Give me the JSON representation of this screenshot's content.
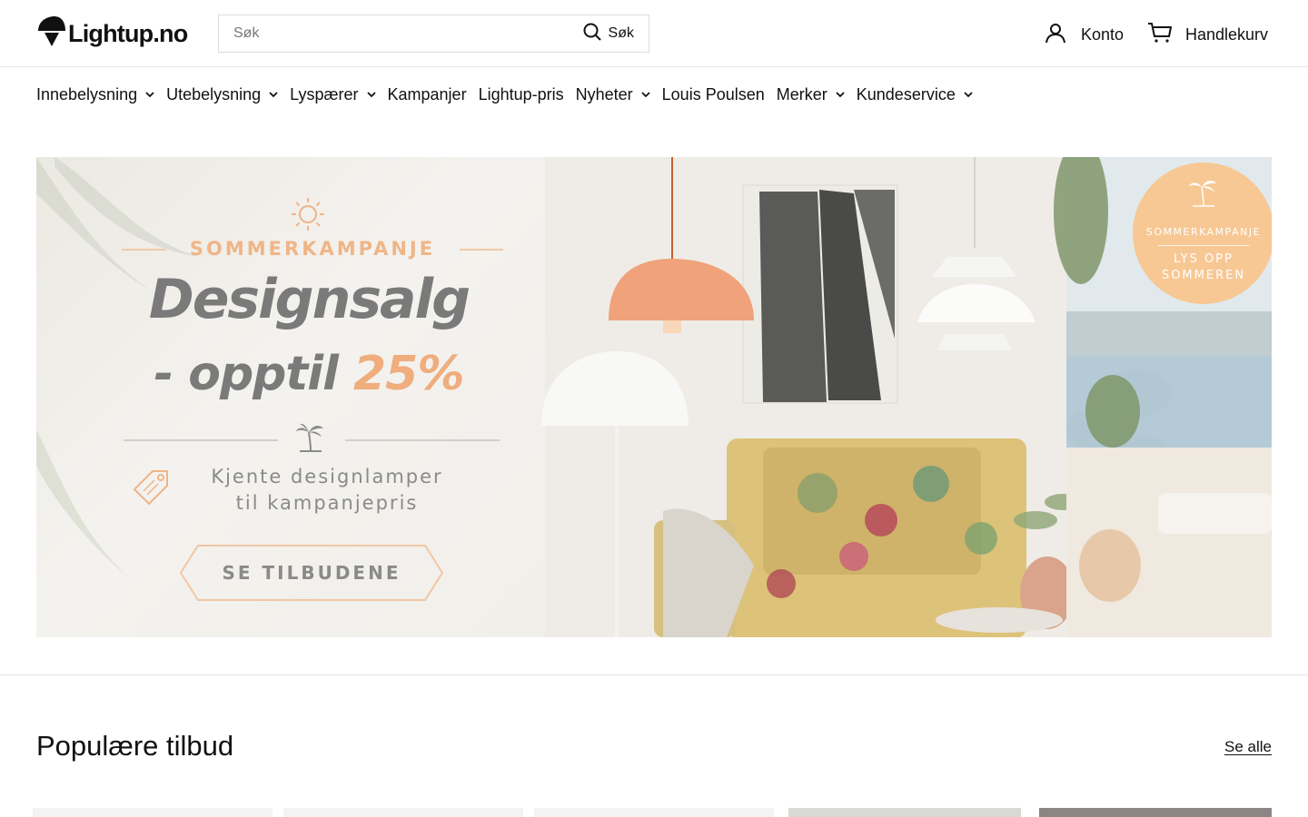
{
  "header": {
    "logo_text": "Lightup.no",
    "search": {
      "placeholder": "Søk",
      "button_label": "Søk"
    },
    "account_label": "Konto",
    "cart_label": "Handlekurv"
  },
  "nav": {
    "items": [
      {
        "label": "Innebelysning",
        "dropdown": true
      },
      {
        "label": "Utebelysning",
        "dropdown": true
      },
      {
        "label": "Lyspærer",
        "dropdown": true
      },
      {
        "label": "Kampanjer",
        "dropdown": false
      },
      {
        "label": "Lightup-pris",
        "dropdown": false
      },
      {
        "label": "Nyheter",
        "dropdown": true
      },
      {
        "label": "Louis Poulsen",
        "dropdown": false
      },
      {
        "label": "Merker",
        "dropdown": true
      },
      {
        "label": "Kundeservice",
        "dropdown": true
      }
    ]
  },
  "banner": {
    "season": "SOMMERKAMPANJE",
    "headline": "Designsalg",
    "subline_prefix": "- opptil ",
    "subline_percent": "25%",
    "tagline_1": "Kjente designlamper",
    "tagline_2": "til kampanjepris",
    "cta_label": "SE TILBUDENE",
    "round_badge": {
      "title": "SOMMERKAMPANJE",
      "line_1": "LYS OPP",
      "line_2": "SOMMEREN"
    },
    "colors": {
      "accent_orange": "#f0ad7e",
      "text_grey": "#7a7a7a",
      "badge_peach": "#f7c894"
    }
  },
  "section": {
    "title": "Populære tilbud",
    "see_all_label": "Se alle"
  },
  "icons": {
    "logo": "lamp-logo-icon",
    "search": "search-icon",
    "account": "user-icon",
    "cart": "cart-icon",
    "chevron": "chevron-down-icon",
    "sun": "sun-icon",
    "palm": "palm-tree-icon",
    "tag": "price-tag-icon"
  }
}
